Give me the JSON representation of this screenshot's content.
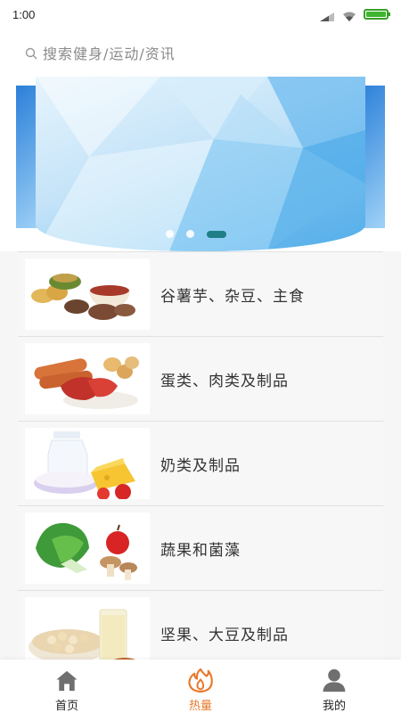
{
  "status_bar": {
    "time": "1:00"
  },
  "search": {
    "placeholder": "搜索健身/运动/资讯"
  },
  "banner": {
    "page_count": 3,
    "active_index": 2
  },
  "categories": [
    {
      "label": "谷薯芋、杂豆、主食",
      "icon": "grains-tubers-image"
    },
    {
      "label": "蛋类、肉类及制品",
      "icon": "eggs-meat-image"
    },
    {
      "label": "奶类及制品",
      "icon": "dairy-image"
    },
    {
      "label": "蔬果和菌藻",
      "icon": "vegetables-fruits-image"
    },
    {
      "label": "坚果、大豆及制品",
      "icon": "nuts-soy-image"
    }
  ],
  "tab_bar": {
    "tabs": [
      {
        "label": "首页",
        "icon": "home-icon",
        "active": false
      },
      {
        "label": "热量",
        "icon": "flame-icon",
        "active": true
      },
      {
        "label": "我的",
        "icon": "user-icon",
        "active": false
      }
    ]
  },
  "colors": {
    "accent": "#e8782a",
    "indicator": "#1f7f86",
    "battery": "#3fb52f"
  }
}
